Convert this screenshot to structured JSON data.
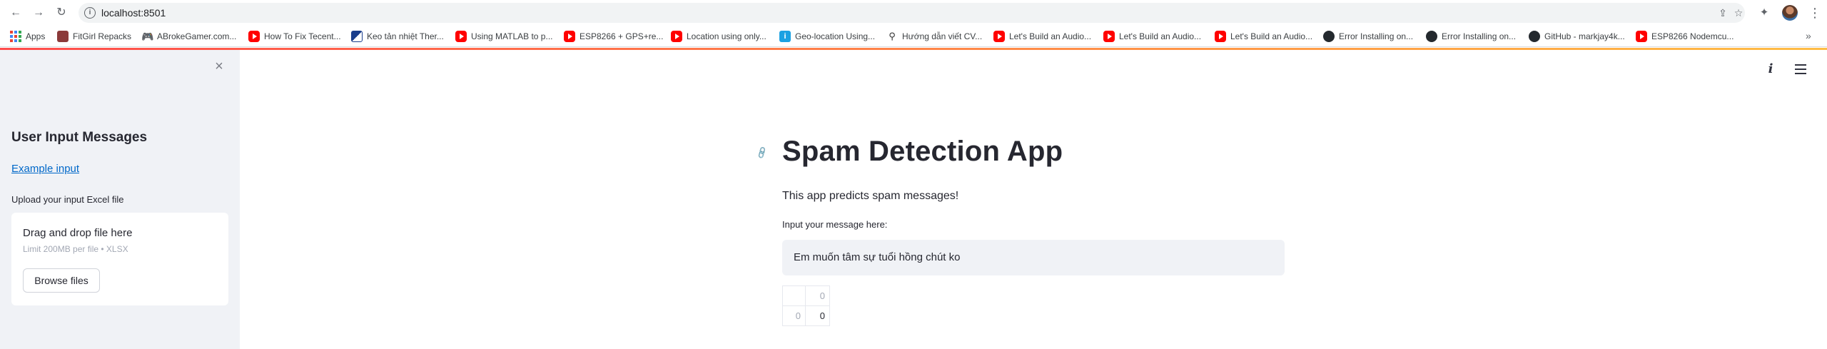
{
  "browser": {
    "url": "localhost:8501",
    "bookmarks": [
      {
        "label": "Apps",
        "icon": "apps-grid-icon"
      },
      {
        "label": "FitGirl Repacks",
        "icon": "fitgirl-favicon"
      },
      {
        "label": "ABrokeGamer.com...",
        "icon": "gamepad-icon"
      },
      {
        "label": "How To Fix Tecent...",
        "icon": "youtube-icon"
      },
      {
        "label": "Keo tản nhiệt Ther...",
        "icon": "flag-favicon"
      },
      {
        "label": "Using MATLAB to p...",
        "icon": "youtube-icon"
      },
      {
        "label": "ESP8266 + GPS+re...",
        "icon": "youtube-icon"
      },
      {
        "label": "Location using only...",
        "icon": "youtube-icon"
      },
      {
        "label": "Geo-location Using...",
        "icon": "geo-favicon"
      },
      {
        "label": "Hướng dẫn viết CV...",
        "icon": "pin-icon"
      },
      {
        "label": "Let's Build an Audio...",
        "icon": "youtube-icon"
      },
      {
        "label": "Let's Build an Audio...",
        "icon": "youtube-icon"
      },
      {
        "label": "Let's Build an Audio...",
        "icon": "youtube-icon"
      },
      {
        "label": "Error Installing on...",
        "icon": "github-icon"
      },
      {
        "label": "Error Installing on...",
        "icon": "github-icon"
      },
      {
        "label": "GitHub - markjay4k...",
        "icon": "github-icon"
      },
      {
        "label": "ESP8266 Nodemcu...",
        "icon": "youtube-icon"
      }
    ],
    "more_bookmarks": "»"
  },
  "sidebar": {
    "heading": "User Input Messages",
    "example_link": "Example input",
    "upload_label": "Upload your input Excel file",
    "dropzone": {
      "title": "Drag and drop file here",
      "limit": "Limit 200MB per file • XLSX",
      "browse_button": "Browse files"
    }
  },
  "main": {
    "title": "Spam Detection App",
    "subtitle": "This app predicts spam messages!",
    "input_label": "Input your message here:",
    "input_value": "Em muốn tâm sự tuổi hồng chút ko",
    "dataframe": {
      "columns": [
        "0"
      ],
      "index": [
        "0"
      ],
      "rows": [
        [
          "0"
        ]
      ]
    }
  },
  "colors": {
    "accent_red": "#ff4b4b",
    "accent_yellow": "#ffbd45",
    "link_blue": "#0068c9",
    "sidebar_bg": "#f0f2f6",
    "text": "#262730"
  }
}
